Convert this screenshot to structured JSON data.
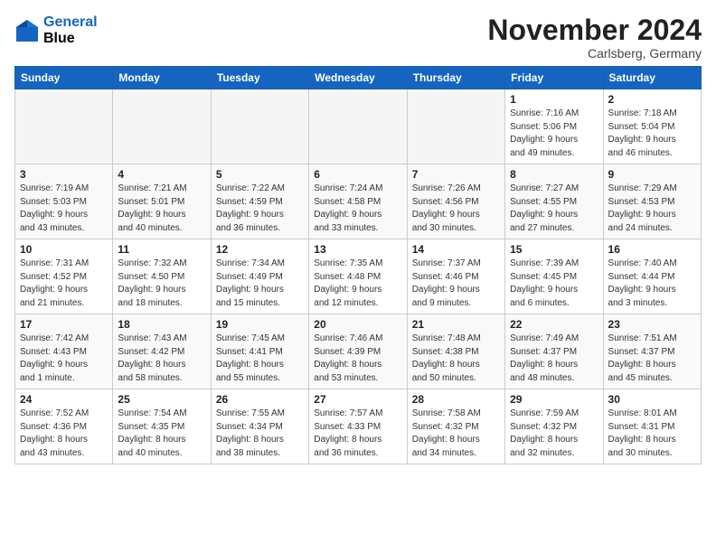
{
  "logo": {
    "line1": "General",
    "line2": "Blue"
  },
  "title": "November 2024",
  "location": "Carlsberg, Germany",
  "weekdays": [
    "Sunday",
    "Monday",
    "Tuesday",
    "Wednesday",
    "Thursday",
    "Friday",
    "Saturday"
  ],
  "weeks": [
    [
      {
        "day": "",
        "info": ""
      },
      {
        "day": "",
        "info": ""
      },
      {
        "day": "",
        "info": ""
      },
      {
        "day": "",
        "info": ""
      },
      {
        "day": "",
        "info": ""
      },
      {
        "day": "1",
        "info": "Sunrise: 7:16 AM\nSunset: 5:06 PM\nDaylight: 9 hours\nand 49 minutes."
      },
      {
        "day": "2",
        "info": "Sunrise: 7:18 AM\nSunset: 5:04 PM\nDaylight: 9 hours\nand 46 minutes."
      }
    ],
    [
      {
        "day": "3",
        "info": "Sunrise: 7:19 AM\nSunset: 5:03 PM\nDaylight: 9 hours\nand 43 minutes."
      },
      {
        "day": "4",
        "info": "Sunrise: 7:21 AM\nSunset: 5:01 PM\nDaylight: 9 hours\nand 40 minutes."
      },
      {
        "day": "5",
        "info": "Sunrise: 7:22 AM\nSunset: 4:59 PM\nDaylight: 9 hours\nand 36 minutes."
      },
      {
        "day": "6",
        "info": "Sunrise: 7:24 AM\nSunset: 4:58 PM\nDaylight: 9 hours\nand 33 minutes."
      },
      {
        "day": "7",
        "info": "Sunrise: 7:26 AM\nSunset: 4:56 PM\nDaylight: 9 hours\nand 30 minutes."
      },
      {
        "day": "8",
        "info": "Sunrise: 7:27 AM\nSunset: 4:55 PM\nDaylight: 9 hours\nand 27 minutes."
      },
      {
        "day": "9",
        "info": "Sunrise: 7:29 AM\nSunset: 4:53 PM\nDaylight: 9 hours\nand 24 minutes."
      }
    ],
    [
      {
        "day": "10",
        "info": "Sunrise: 7:31 AM\nSunset: 4:52 PM\nDaylight: 9 hours\nand 21 minutes."
      },
      {
        "day": "11",
        "info": "Sunrise: 7:32 AM\nSunset: 4:50 PM\nDaylight: 9 hours\nand 18 minutes."
      },
      {
        "day": "12",
        "info": "Sunrise: 7:34 AM\nSunset: 4:49 PM\nDaylight: 9 hours\nand 15 minutes."
      },
      {
        "day": "13",
        "info": "Sunrise: 7:35 AM\nSunset: 4:48 PM\nDaylight: 9 hours\nand 12 minutes."
      },
      {
        "day": "14",
        "info": "Sunrise: 7:37 AM\nSunset: 4:46 PM\nDaylight: 9 hours\nand 9 minutes."
      },
      {
        "day": "15",
        "info": "Sunrise: 7:39 AM\nSunset: 4:45 PM\nDaylight: 9 hours\nand 6 minutes."
      },
      {
        "day": "16",
        "info": "Sunrise: 7:40 AM\nSunset: 4:44 PM\nDaylight: 9 hours\nand 3 minutes."
      }
    ],
    [
      {
        "day": "17",
        "info": "Sunrise: 7:42 AM\nSunset: 4:43 PM\nDaylight: 9 hours\nand 1 minute."
      },
      {
        "day": "18",
        "info": "Sunrise: 7:43 AM\nSunset: 4:42 PM\nDaylight: 8 hours\nand 58 minutes."
      },
      {
        "day": "19",
        "info": "Sunrise: 7:45 AM\nSunset: 4:41 PM\nDaylight: 8 hours\nand 55 minutes."
      },
      {
        "day": "20",
        "info": "Sunrise: 7:46 AM\nSunset: 4:39 PM\nDaylight: 8 hours\nand 53 minutes."
      },
      {
        "day": "21",
        "info": "Sunrise: 7:48 AM\nSunset: 4:38 PM\nDaylight: 8 hours\nand 50 minutes."
      },
      {
        "day": "22",
        "info": "Sunrise: 7:49 AM\nSunset: 4:37 PM\nDaylight: 8 hours\nand 48 minutes."
      },
      {
        "day": "23",
        "info": "Sunrise: 7:51 AM\nSunset: 4:37 PM\nDaylight: 8 hours\nand 45 minutes."
      }
    ],
    [
      {
        "day": "24",
        "info": "Sunrise: 7:52 AM\nSunset: 4:36 PM\nDaylight: 8 hours\nand 43 minutes."
      },
      {
        "day": "25",
        "info": "Sunrise: 7:54 AM\nSunset: 4:35 PM\nDaylight: 8 hours\nand 40 minutes."
      },
      {
        "day": "26",
        "info": "Sunrise: 7:55 AM\nSunset: 4:34 PM\nDaylight: 8 hours\nand 38 minutes."
      },
      {
        "day": "27",
        "info": "Sunrise: 7:57 AM\nSunset: 4:33 PM\nDaylight: 8 hours\nand 36 minutes."
      },
      {
        "day": "28",
        "info": "Sunrise: 7:58 AM\nSunset: 4:32 PM\nDaylight: 8 hours\nand 34 minutes."
      },
      {
        "day": "29",
        "info": "Sunrise: 7:59 AM\nSunset: 4:32 PM\nDaylight: 8 hours\nand 32 minutes."
      },
      {
        "day": "30",
        "info": "Sunrise: 8:01 AM\nSunset: 4:31 PM\nDaylight: 8 hours\nand 30 minutes."
      }
    ]
  ]
}
